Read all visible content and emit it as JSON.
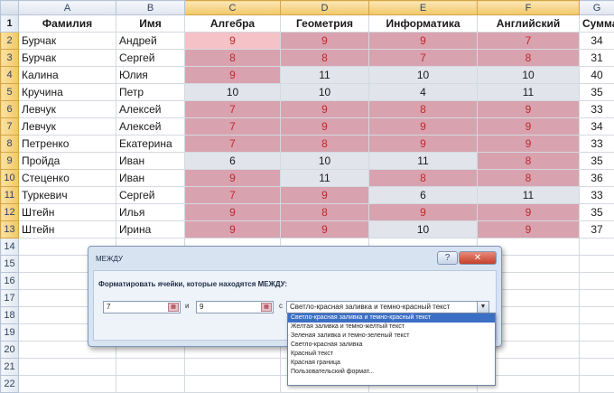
{
  "columns": [
    "A",
    "B",
    "C",
    "D",
    "E",
    "F",
    "G"
  ],
  "selected_columns": [
    "C",
    "D",
    "E",
    "F"
  ],
  "header_row": {
    "number": "1",
    "cells": [
      "Фамилия",
      "Имя",
      "Алгебра",
      "Геометрия",
      "Информатика",
      "Английский",
      "Сумма"
    ]
  },
  "rows": [
    {
      "n": "2",
      "last": "Бурчак",
      "first": "Андрей",
      "scores": [
        {
          "v": "9",
          "s": "lite"
        },
        {
          "v": "9",
          "s": "hl"
        },
        {
          "v": "9",
          "s": "hl"
        },
        {
          "v": "7",
          "s": "hl"
        }
      ],
      "sum": "34"
    },
    {
      "n": "3",
      "last": "Бурчак",
      "first": "Сергей",
      "scores": [
        {
          "v": "8",
          "s": "hl"
        },
        {
          "v": "8",
          "s": "hl"
        },
        {
          "v": "7",
          "s": "hl"
        },
        {
          "v": "8",
          "s": "hl"
        }
      ],
      "sum": "31"
    },
    {
      "n": "4",
      "last": "Калина",
      "first": "Юлия",
      "scores": [
        {
          "v": "9",
          "s": "hl"
        },
        {
          "v": "11",
          "s": "pl"
        },
        {
          "v": "10",
          "s": "pl"
        },
        {
          "v": "10",
          "s": "pl"
        }
      ],
      "sum": "40"
    },
    {
      "n": "5",
      "last": "Кручина",
      "first": "Петр",
      "scores": [
        {
          "v": "10",
          "s": "pl"
        },
        {
          "v": "10",
          "s": "pl"
        },
        {
          "v": "4",
          "s": "pl"
        },
        {
          "v": "11",
          "s": "pl"
        }
      ],
      "sum": "35"
    },
    {
      "n": "6",
      "last": "Левчук",
      "first": "Алексей",
      "scores": [
        {
          "v": "7",
          "s": "hl"
        },
        {
          "v": "9",
          "s": "hl"
        },
        {
          "v": "8",
          "s": "hl"
        },
        {
          "v": "9",
          "s": "hl"
        }
      ],
      "sum": "33"
    },
    {
      "n": "7",
      "last": "Левчук",
      "first": "Алексей",
      "scores": [
        {
          "v": "7",
          "s": "hl"
        },
        {
          "v": "9",
          "s": "hl"
        },
        {
          "v": "9",
          "s": "hl"
        },
        {
          "v": "9",
          "s": "hl"
        }
      ],
      "sum": "34"
    },
    {
      "n": "8",
      "last": "Петренко",
      "first": "Екатерина",
      "scores": [
        {
          "v": "7",
          "s": "hl"
        },
        {
          "v": "8",
          "s": "hl"
        },
        {
          "v": "9",
          "s": "hl"
        },
        {
          "v": "9",
          "s": "hl"
        }
      ],
      "sum": "33"
    },
    {
      "n": "9",
      "last": "Пройда",
      "first": "Иван",
      "scores": [
        {
          "v": "6",
          "s": "pl"
        },
        {
          "v": "10",
          "s": "pl"
        },
        {
          "v": "11",
          "s": "pl"
        },
        {
          "v": "8",
          "s": "hl"
        }
      ],
      "sum": "35"
    },
    {
      "n": "10",
      "last": "Стеценко",
      "first": "Иван",
      "scores": [
        {
          "v": "9",
          "s": "hl"
        },
        {
          "v": "11",
          "s": "pl"
        },
        {
          "v": "8",
          "s": "hl"
        },
        {
          "v": "8",
          "s": "hl"
        }
      ],
      "sum": "36"
    },
    {
      "n": "11",
      "last": "Туркевич",
      "first": "Сергей",
      "scores": [
        {
          "v": "7",
          "s": "hl"
        },
        {
          "v": "9",
          "s": "hl"
        },
        {
          "v": "6",
          "s": "pl"
        },
        {
          "v": "11",
          "s": "pl"
        }
      ],
      "sum": "33"
    },
    {
      "n": "12",
      "last": "Штейн",
      "first": "Илья",
      "scores": [
        {
          "v": "9",
          "s": "hl"
        },
        {
          "v": "8",
          "s": "hl"
        },
        {
          "v": "9",
          "s": "hl"
        },
        {
          "v": "9",
          "s": "hl"
        }
      ],
      "sum": "35"
    },
    {
      "n": "13",
      "last": "Штейн",
      "first": "Ирина",
      "scores": [
        {
          "v": "9",
          "s": "hl"
        },
        {
          "v": "9",
          "s": "hl"
        },
        {
          "v": "10",
          "s": "pl"
        },
        {
          "v": "9",
          "s": "hl"
        }
      ],
      "sum": "37"
    }
  ],
  "empty_rows": [
    "14",
    "15",
    "16",
    "17",
    "18",
    "19",
    "20",
    "21",
    "22"
  ],
  "colors": {
    "highlight_fill": "#d8a2af",
    "highlight_text": "#c0282d",
    "selected_header": "#f2c766"
  },
  "dialog": {
    "title": "МЕЖДУ",
    "help_button": "?",
    "close_button": "✕",
    "prompt": "Форматировать ячейки, которые находятся МЕЖДУ:",
    "from_value": "7",
    "and_label": "и",
    "to_value": "9",
    "with_label": "с",
    "format_value": "Светло-красная заливка и темно-красный текст",
    "ref_icon": "▦",
    "dropdown_arrow": "▼"
  },
  "dropdown": {
    "options": [
      "Светло-красная заливка и темно-красный текст",
      "Желтая заливка и темно-желтый текст",
      "Зеленая заливка и темно-зеленый текст",
      "Светло-красная заливка",
      "Красный текст",
      "Красная граница",
      "Пользовательский формат..."
    ],
    "active_index": 0
  }
}
